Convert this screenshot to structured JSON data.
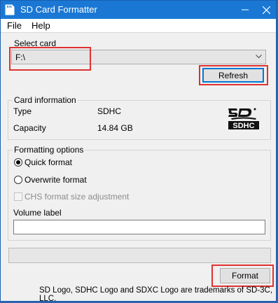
{
  "window": {
    "title": "SD Card Formatter"
  },
  "menu": {
    "file": "File",
    "help": "Help"
  },
  "select_card": {
    "caption": "Select card",
    "value": "F:\\",
    "refresh_label": "Refresh"
  },
  "card_info": {
    "caption": "Card information",
    "type_label": "Type",
    "type_value": "SDHC",
    "capacity_label": "Capacity",
    "capacity_value": "14.84 GB",
    "logo_text": "SDHC"
  },
  "formatting": {
    "caption": "Formatting options",
    "quick_format": "Quick format",
    "quick_format_selected": true,
    "overwrite_format": "Overwrite format",
    "chs_label": "CHS format size adjustment",
    "chs_checked": false,
    "volume_label_caption": "Volume label",
    "volume_label_value": ""
  },
  "progress": {
    "fraction": 0
  },
  "format_label": "Format",
  "footer": "SD Logo, SDHC Logo and SDXC Logo are trademarks of SD-3C, LLC.",
  "colors": {
    "titlebar": "#1a78d4",
    "highlight": "#e03131",
    "default_button_border": "#0078d7"
  }
}
